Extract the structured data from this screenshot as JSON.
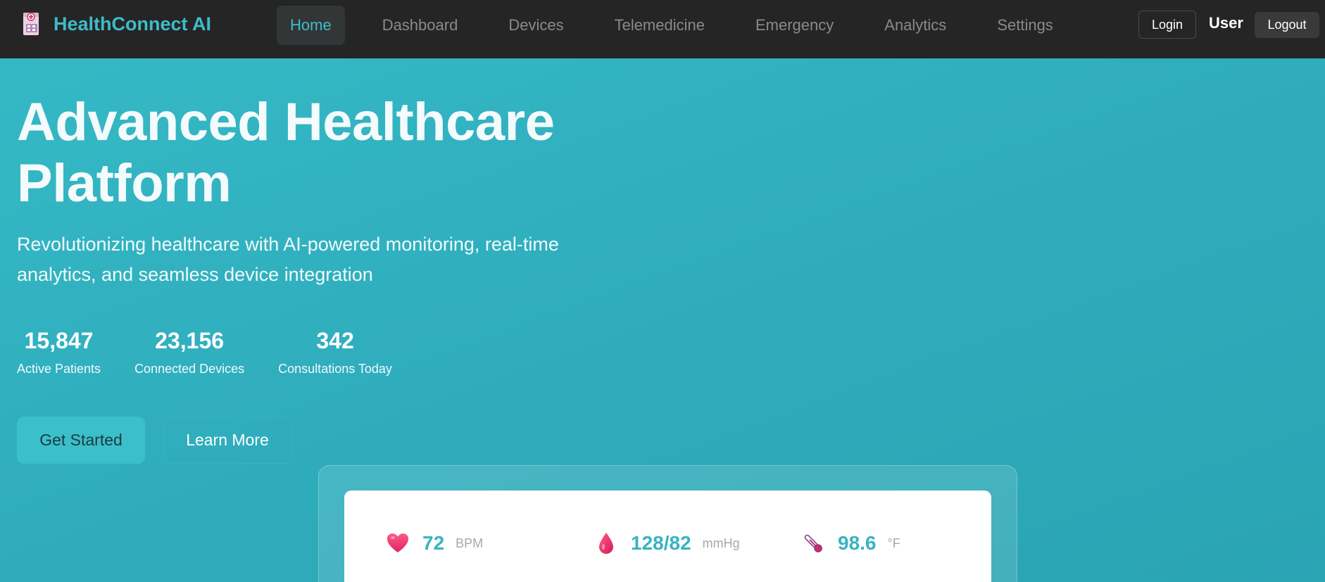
{
  "navbar": {
    "brand": "HealthConnect AI",
    "links": [
      "Home",
      "Dashboard",
      "Devices",
      "Telemedicine",
      "Emergency",
      "Analytics",
      "Settings"
    ],
    "active": "Home",
    "login_label": "Login",
    "user_label": "User",
    "logout_label": "Logout"
  },
  "hero": {
    "title": "Advanced Healthcare Platform",
    "subtitle": "Revolutionizing healthcare with AI-powered monitoring, real-time analytics, and seamless device integration",
    "stats": [
      {
        "value": "15,847",
        "label": "Active Patients"
      },
      {
        "value": "23,156",
        "label": "Connected Devices"
      },
      {
        "value": "342",
        "label": "Consultations Today"
      }
    ],
    "primary_button": "Get Started",
    "secondary_button": "Learn More"
  },
  "vitals": [
    {
      "icon": "heart-icon",
      "value": "72",
      "unit": "BPM"
    },
    {
      "icon": "blood-drop-icon",
      "value": "128/82",
      "unit": "mmHg"
    },
    {
      "icon": "thermometer-icon",
      "value": "98.6",
      "unit": "°F"
    }
  ],
  "colors": {
    "accent": "#3dbcc9",
    "nav_bg": "#252525",
    "hero_bg": "#2fadbd"
  }
}
